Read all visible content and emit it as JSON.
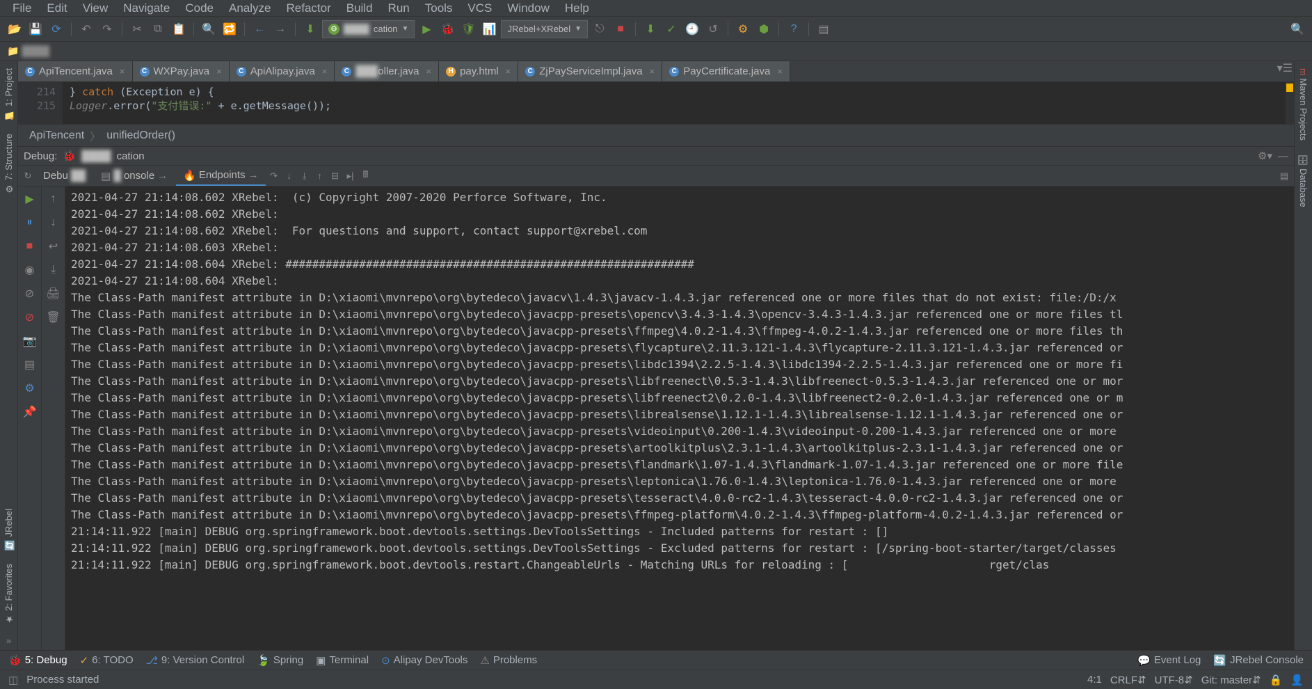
{
  "menus": [
    "File",
    "Edit",
    "View",
    "Navigate",
    "Code",
    "Analyze",
    "Refactor",
    "Build",
    "Run",
    "Tools",
    "VCS",
    "Window",
    "Help"
  ],
  "toolbar": {
    "runconfig": "cation",
    "jrebel_dropdown": "JRebel+XRebel"
  },
  "breadcrumb_top": "",
  "tabs": [
    {
      "label": "ApiTencent.java",
      "icon": "C",
      "active": true
    },
    {
      "label": "WXPay.java",
      "icon": "C"
    },
    {
      "label": "ApiAlipay.java",
      "icon": "C"
    },
    {
      "label": "oller.java",
      "icon": "C"
    },
    {
      "label": "pay.html",
      "icon": "H"
    },
    {
      "label": "ZjPayServiceImpl.java",
      "icon": "C"
    },
    {
      "label": "PayCertificate.java",
      "icon": "C"
    }
  ],
  "editor": {
    "line1_num": "214",
    "line2_num": "215",
    "line1_code": "        } catch (Exception e) {",
    "line2_prefix": "            Logger.error(",
    "line2_str": "\"支付错误:\"",
    "line2_suffix": " + e.getMessage());"
  },
  "breadcrumb_nav": {
    "a": "ApiTencent",
    "b": "unifiedOrder()"
  },
  "debug_header": {
    "label": "Debug:",
    "app": "cation"
  },
  "debug_tabs": {
    "debugger": "Debu",
    "console": "onsole",
    "endpoints": "Endpoints"
  },
  "console_lines": [
    "2021-04-27 21:14:08.602 XRebel:  (c) Copyright 2007-2020 Perforce Software, Inc.",
    "2021-04-27 21:14:08.602 XRebel:",
    "2021-04-27 21:14:08.602 XRebel:  For questions and support, contact support@xrebel.com",
    "2021-04-27 21:14:08.603 XRebel:",
    "2021-04-27 21:14:08.604 XRebel: #############################################################",
    "2021-04-27 21:14:08.604 XRebel:",
    "The Class-Path manifest attribute in D:\\xiaomi\\mvnrepo\\org\\bytedeco\\javacv\\1.4.3\\javacv-1.4.3.jar referenced one or more files that do not exist: file:/D:/x",
    "The Class-Path manifest attribute in D:\\xiaomi\\mvnrepo\\org\\bytedeco\\javacpp-presets\\opencv\\3.4.3-1.4.3\\opencv-3.4.3-1.4.3.jar referenced one or more files tl",
    "The Class-Path manifest attribute in D:\\xiaomi\\mvnrepo\\org\\bytedeco\\javacpp-presets\\ffmpeg\\4.0.2-1.4.3\\ffmpeg-4.0.2-1.4.3.jar referenced one or more files th",
    "The Class-Path manifest attribute in D:\\xiaomi\\mvnrepo\\org\\bytedeco\\javacpp-presets\\flycapture\\2.11.3.121-1.4.3\\flycapture-2.11.3.121-1.4.3.jar referenced or",
    "The Class-Path manifest attribute in D:\\xiaomi\\mvnrepo\\org\\bytedeco\\javacpp-presets\\libdc1394\\2.2.5-1.4.3\\libdc1394-2.2.5-1.4.3.jar referenced one or more fi",
    "The Class-Path manifest attribute in D:\\xiaomi\\mvnrepo\\org\\bytedeco\\javacpp-presets\\libfreenect\\0.5.3-1.4.3\\libfreenect-0.5.3-1.4.3.jar referenced one or mor",
    "The Class-Path manifest attribute in D:\\xiaomi\\mvnrepo\\org\\bytedeco\\javacpp-presets\\libfreenect2\\0.2.0-1.4.3\\libfreenect2-0.2.0-1.4.3.jar referenced one or m",
    "The Class-Path manifest attribute in D:\\xiaomi\\mvnrepo\\org\\bytedeco\\javacpp-presets\\librealsense\\1.12.1-1.4.3\\librealsense-1.12.1-1.4.3.jar referenced one or",
    "The Class-Path manifest attribute in D:\\xiaomi\\mvnrepo\\org\\bytedeco\\javacpp-presets\\videoinput\\0.200-1.4.3\\videoinput-0.200-1.4.3.jar referenced one or more ",
    "The Class-Path manifest attribute in D:\\xiaomi\\mvnrepo\\org\\bytedeco\\javacpp-presets\\artoolkitplus\\2.3.1-1.4.3\\artoolkitplus-2.3.1-1.4.3.jar referenced one or",
    "The Class-Path manifest attribute in D:\\xiaomi\\mvnrepo\\org\\bytedeco\\javacpp-presets\\flandmark\\1.07-1.4.3\\flandmark-1.07-1.4.3.jar referenced one or more file",
    "The Class-Path manifest attribute in D:\\xiaomi\\mvnrepo\\org\\bytedeco\\javacpp-presets\\leptonica\\1.76.0-1.4.3\\leptonica-1.76.0-1.4.3.jar referenced one or more ",
    "The Class-Path manifest attribute in D:\\xiaomi\\mvnrepo\\org\\bytedeco\\javacpp-presets\\tesseract\\4.0.0-rc2-1.4.3\\tesseract-4.0.0-rc2-1.4.3.jar referenced one or",
    "The Class-Path manifest attribute in D:\\xiaomi\\mvnrepo\\org\\bytedeco\\javacpp-presets\\ffmpeg-platform\\4.0.2-1.4.3\\ffmpeg-platform-4.0.2-1.4.3.jar referenced or",
    "21:14:11.922 [main] DEBUG org.springframework.boot.devtools.settings.DevToolsSettings - Included patterns for restart : []",
    "21:14:11.922 [main] DEBUG org.springframework.boot.devtools.settings.DevToolsSettings - Excluded patterns for restart : [/spring-boot-starter/target/classes",
    "21:14:11.922 [main] DEBUG org.springframework.boot.devtools.restart.ChangeableUrls - Matching URLs for reloading : [                     rget/clas"
  ],
  "bottom": {
    "debug": "5: Debug",
    "todo": "6: TODO",
    "vcs": "9: Version Control",
    "spring": "Spring",
    "terminal": "Terminal",
    "alipay": "Alipay DevTools",
    "problems": "Problems",
    "eventlog": "Event Log",
    "jrebel": "JRebel Console"
  },
  "status": {
    "msg": "Process started",
    "pos": "4:1",
    "line_ending": "CRLF",
    "encoding": "UTF-8",
    "git": "Git: master"
  },
  "left_strip": {
    "project": "1: Project",
    "structure": "7: Structure",
    "jrebel": "JRebel",
    "favorites": "2: Favorites"
  },
  "right_strip": {
    "maven": "Maven Projects",
    "database": "Database"
  }
}
